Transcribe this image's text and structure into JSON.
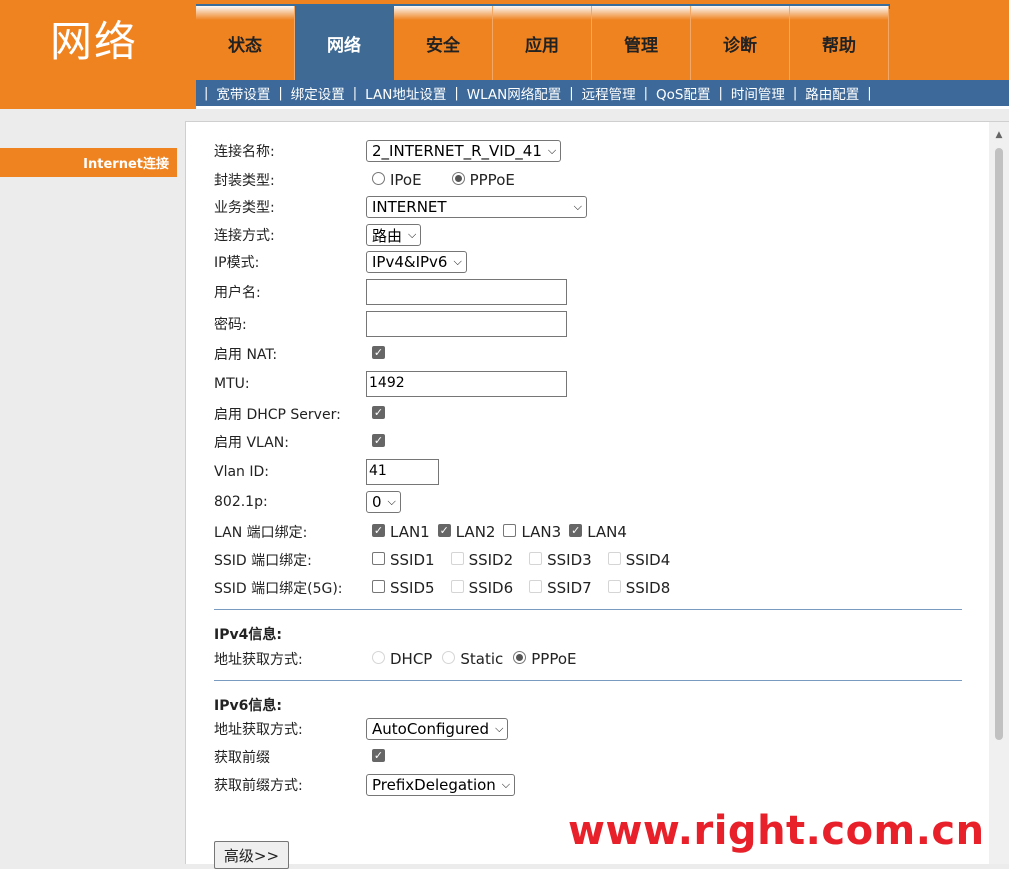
{
  "header": {
    "logo": "网络",
    "tabs": [
      {
        "label": "状态",
        "active": false
      },
      {
        "label": "网络",
        "active": true
      },
      {
        "label": "安全",
        "active": false
      },
      {
        "label": "应用",
        "active": false
      },
      {
        "label": "管理",
        "active": false
      },
      {
        "label": "诊断",
        "active": false
      },
      {
        "label": "帮助",
        "active": false
      }
    ],
    "subnav": [
      "宽带设置",
      "绑定设置",
      "LAN地址设置",
      "WLAN网络配置",
      "远程管理",
      "QoS配置",
      "时间管理",
      "路由配置"
    ]
  },
  "sidebar": {
    "item": "Internet连接"
  },
  "form": {
    "conn_name": {
      "label": "连接名称:",
      "value": "2_INTERNET_R_VID_41"
    },
    "encap": {
      "label": "封装类型:",
      "options": [
        "IPoE",
        "PPPoE"
      ],
      "selected": "PPPoE"
    },
    "service": {
      "label": "业务类型:",
      "value": "INTERNET"
    },
    "conn_mode": {
      "label": "连接方式:",
      "value": "路由"
    },
    "ip_mode": {
      "label": "IP模式:",
      "value": "IPv4&IPv6"
    },
    "username": {
      "label": "用户名:",
      "value": ""
    },
    "password": {
      "label": "密码:",
      "value": ""
    },
    "nat": {
      "label": "启用 NAT:",
      "checked": true
    },
    "mtu": {
      "label": "MTU:",
      "value": "1492"
    },
    "dhcp_server": {
      "label": "启用 DHCP Server:",
      "checked": true
    },
    "vlan": {
      "label": "启用 VLAN:",
      "checked": true
    },
    "vlan_id": {
      "label": "Vlan ID:",
      "value": "41"
    },
    "dot1p": {
      "label": "802.1p:",
      "value": "0"
    },
    "lan_bind": {
      "label": "LAN 端口绑定:",
      "ports": [
        {
          "name": "LAN1",
          "checked": true
        },
        {
          "name": "LAN2",
          "checked": true
        },
        {
          "name": "LAN3",
          "checked": false
        },
        {
          "name": "LAN4",
          "checked": true
        }
      ]
    },
    "ssid_bind": {
      "label": "SSID 端口绑定:",
      "ports": [
        {
          "name": "SSID1",
          "enabled": true
        },
        {
          "name": "SSID2",
          "enabled": false
        },
        {
          "name": "SSID3",
          "enabled": false
        },
        {
          "name": "SSID4",
          "enabled": false
        }
      ]
    },
    "ssid_bind_5g": {
      "label": "SSID 端口绑定(5G):",
      "ports": [
        {
          "name": "SSID5",
          "enabled": true
        },
        {
          "name": "SSID6",
          "enabled": false
        },
        {
          "name": "SSID7",
          "enabled": false
        },
        {
          "name": "SSID8",
          "enabled": false
        }
      ]
    }
  },
  "ipv4": {
    "title": "IPv4信息:",
    "addr_label": "地址获取方式:",
    "options": [
      "DHCP",
      "Static",
      "PPPoE"
    ],
    "selected": "PPPoE"
  },
  "ipv6": {
    "title": "IPv6信息:",
    "addr_label": "地址获取方式:",
    "addr_value": "AutoConfigured",
    "prefix_label": "获取前缀",
    "prefix_checked": true,
    "prefix_mode_label": "获取前缀方式:",
    "prefix_mode_value": "PrefixDelegation"
  },
  "advanced_button": "高级>>",
  "watermark": "www.right.com.cn"
}
